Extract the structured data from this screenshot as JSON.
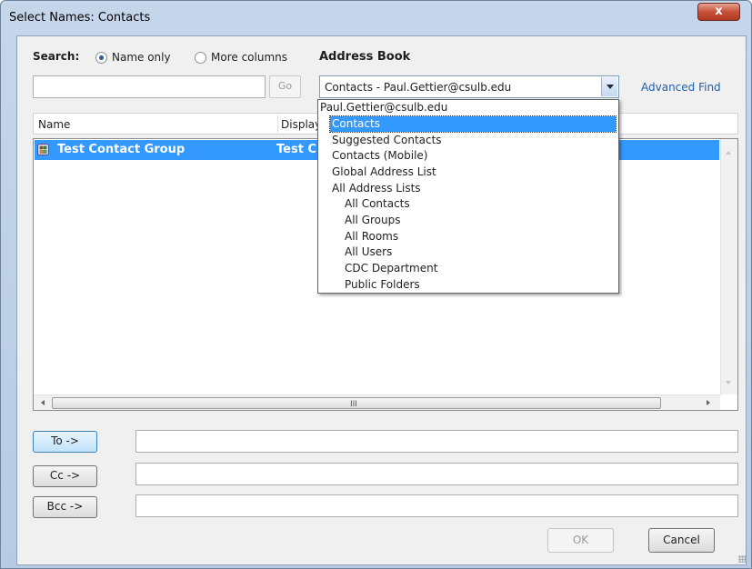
{
  "window": {
    "title": "Select Names: Contacts",
    "close_label": "x"
  },
  "search": {
    "label": "Search:",
    "query": "",
    "go_label": "Go",
    "options": [
      {
        "label": "Name only",
        "selected": true
      },
      {
        "label": "More columns",
        "selected": false
      }
    ]
  },
  "address_book": {
    "label": "Address Book",
    "selected": "Contacts - Paul.Gettier@csulb.edu",
    "advanced_find": "Advanced Find",
    "dropdown": {
      "items": [
        {
          "label": "Paul.Gettier@csulb.edu",
          "level": 0,
          "selected": false
        },
        {
          "label": "Contacts",
          "level": 1,
          "selected": true
        },
        {
          "label": "Suggested Contacts",
          "level": 1,
          "selected": false
        },
        {
          "label": "Contacts (Mobile)",
          "level": 1,
          "selected": false
        },
        {
          "label": "Global Address List",
          "level": 1,
          "selected": false
        },
        {
          "label": "All Address Lists",
          "level": 1,
          "selected": false
        },
        {
          "label": "All Contacts",
          "level": 2,
          "selected": false
        },
        {
          "label": "All Groups",
          "level": 2,
          "selected": false
        },
        {
          "label": "All Rooms",
          "level": 2,
          "selected": false
        },
        {
          "label": "All Users",
          "level": 2,
          "selected": false
        },
        {
          "label": "CDC Department",
          "level": 2,
          "selected": false
        },
        {
          "label": "Public Folders",
          "level": 2,
          "selected": false
        }
      ]
    }
  },
  "list": {
    "columns": {
      "name": "Name",
      "display": "Display"
    },
    "rows": [
      {
        "name": "Test Contact Group",
        "display": "Test C",
        "selected": true
      }
    ],
    "hscroll_grip": "III"
  },
  "recipients": [
    {
      "button": "To ->",
      "value": "",
      "focused": true
    },
    {
      "button": "Cc ->",
      "value": "",
      "focused": false
    },
    {
      "button": "Bcc ->",
      "value": "",
      "focused": false
    }
  ],
  "buttons": {
    "ok": "OK",
    "cancel": "Cancel"
  },
  "colors": {
    "selection": "#3399ff",
    "link": "#1c5fae",
    "title_bar": "#c6d6ea"
  }
}
